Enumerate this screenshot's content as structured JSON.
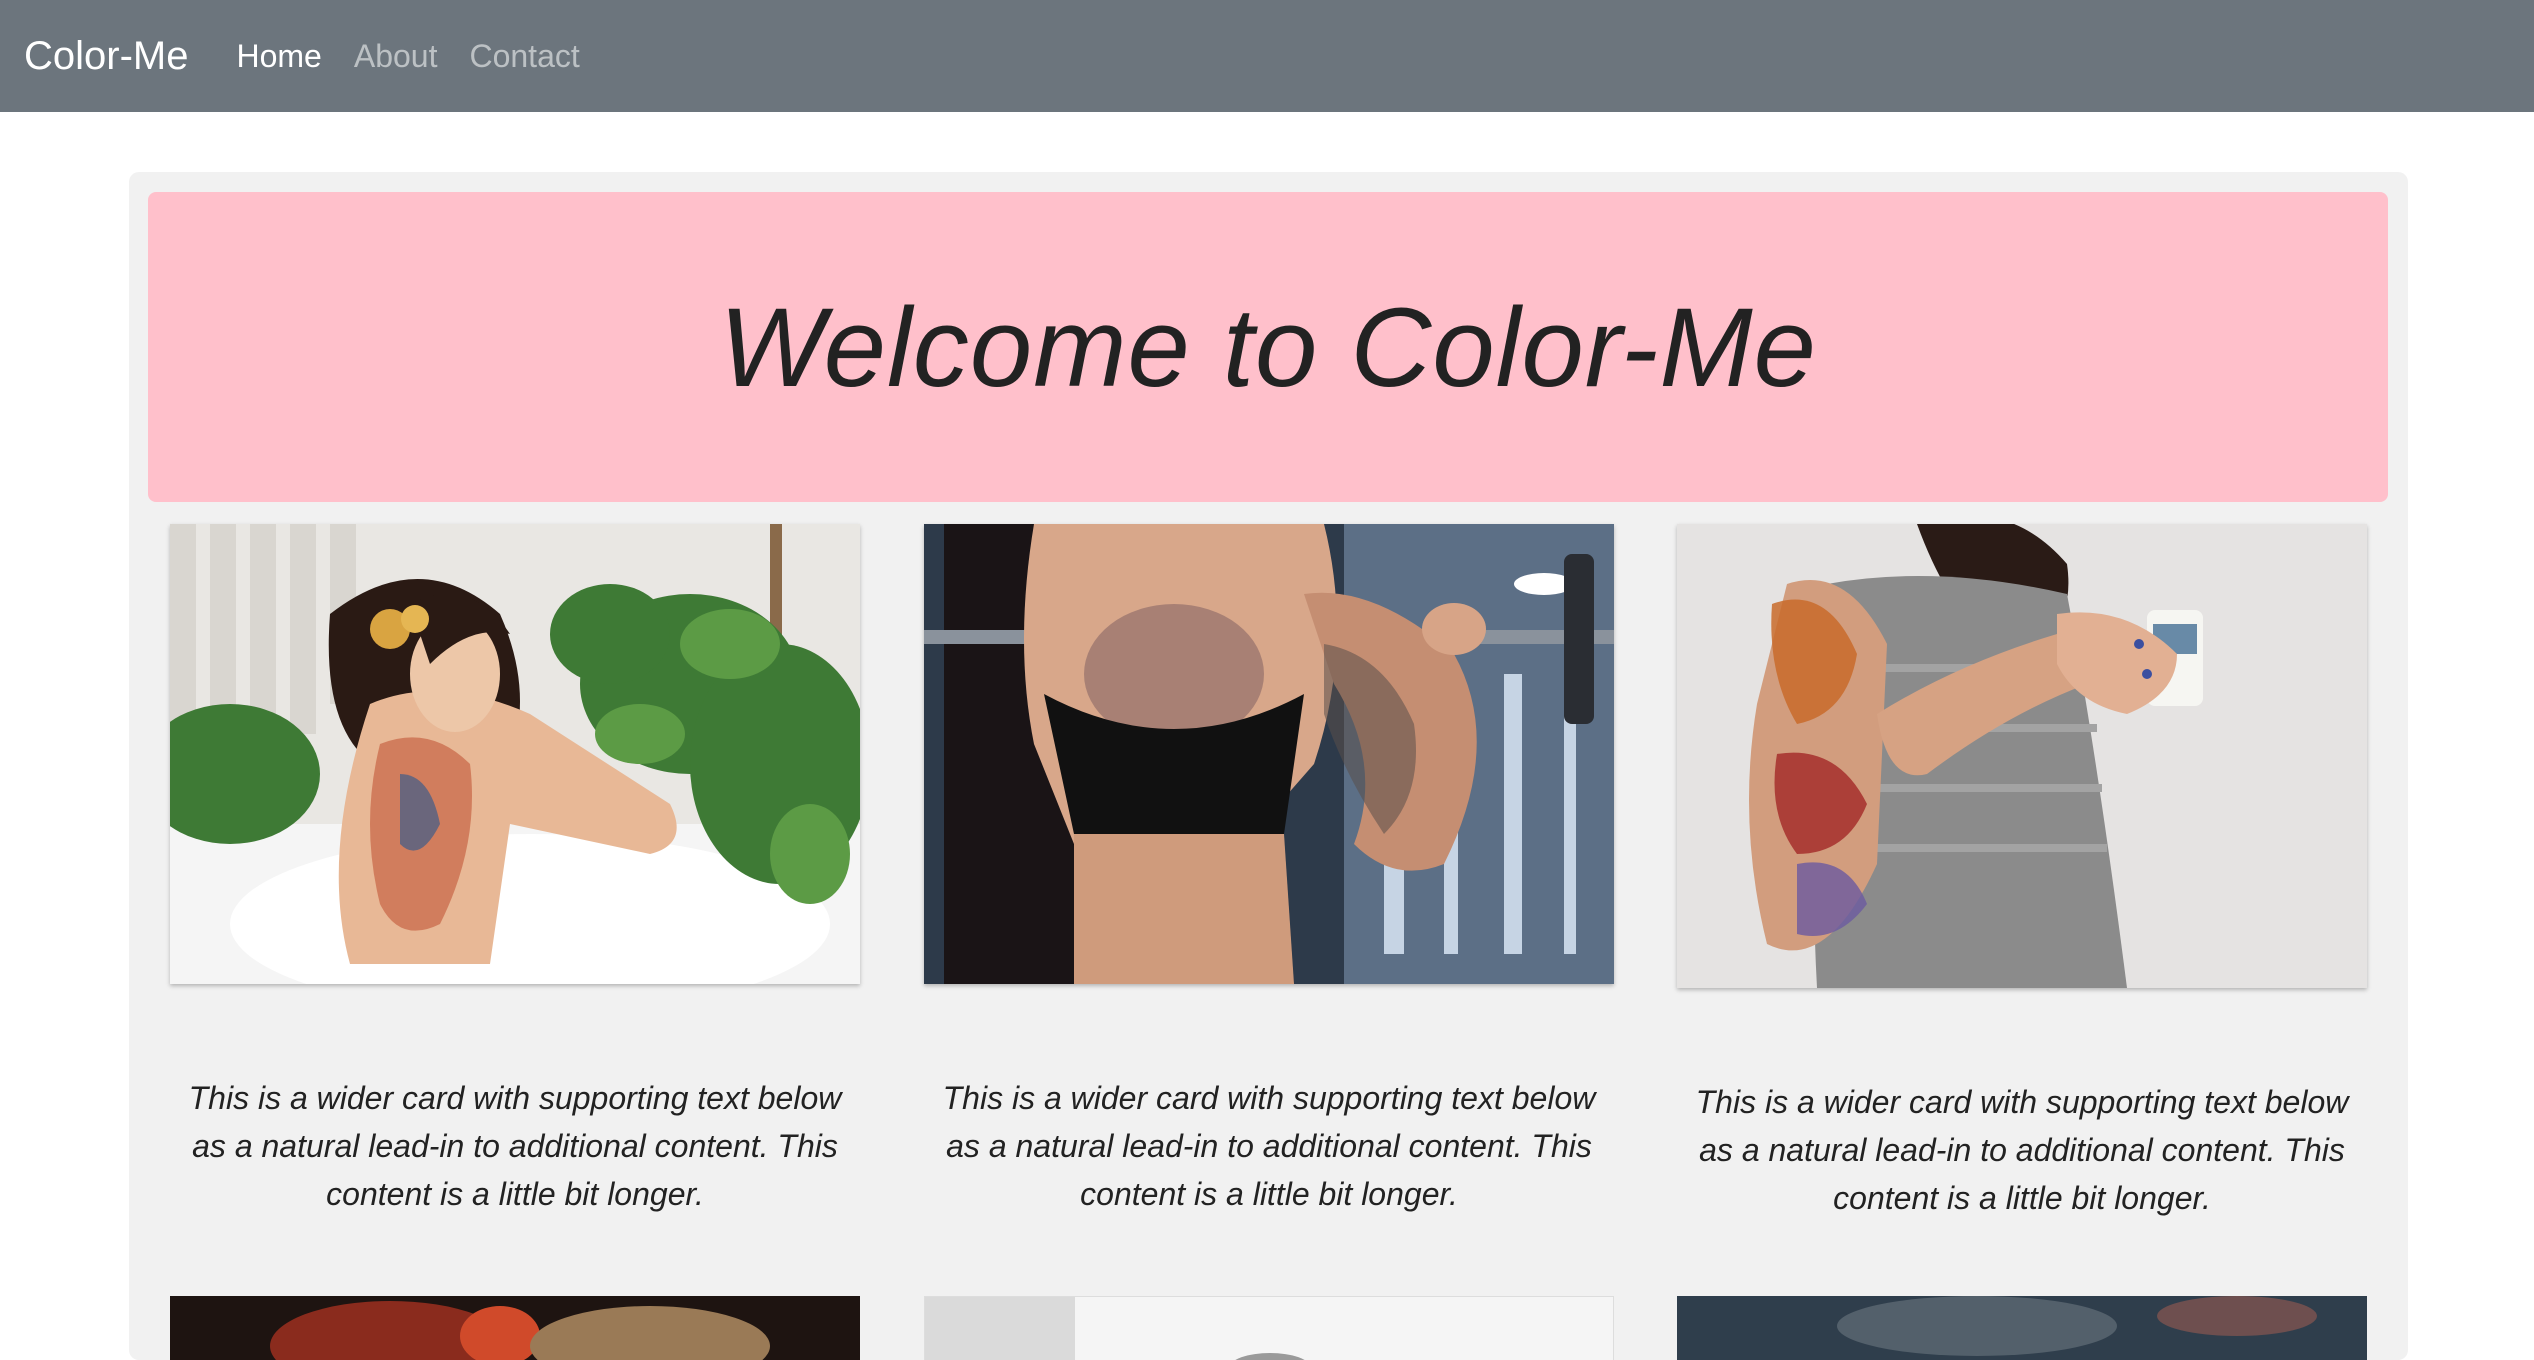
{
  "navbar": {
    "brand": "Color-Me",
    "links": [
      {
        "label": "Home",
        "active": true
      },
      {
        "label": "About",
        "active": false
      },
      {
        "label": "Contact",
        "active": false
      }
    ]
  },
  "hero": {
    "title": "Welcome to Color-Me",
    "background": "#ffc0cb"
  },
  "cards": [
    {
      "image": "tattooed-woman-in-bath",
      "text": "This is a wider card with supporting text below as a natural lead-in to additional content. This content is a little bit longer."
    },
    {
      "image": "tattooed-woman-with-barbell",
      "text": "This is a wider card with supporting text below as a natural lead-in to additional content. This content is a little bit longer."
    },
    {
      "image": "tattooed-woman-with-mug",
      "text": "This is a wider card with supporting text below as a natural lead-in to additional content. This content is a little bit longer."
    }
  ],
  "colors": {
    "navbar": "#6c757d",
    "page": "#f1f1f1"
  }
}
